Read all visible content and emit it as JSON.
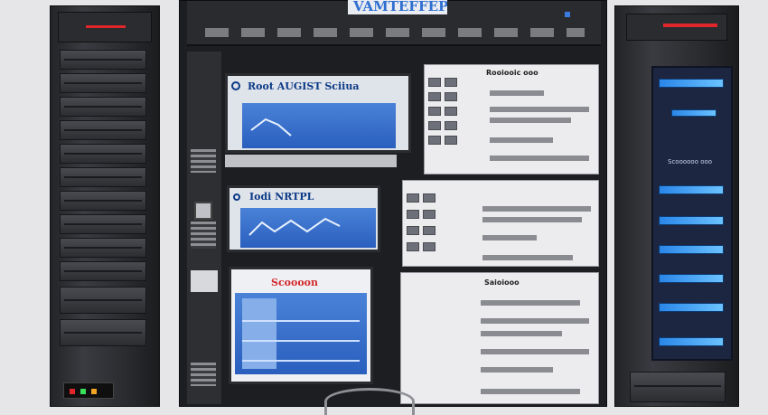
{
  "rack": {
    "banner": "VAMTEFFEP",
    "screens": [
      {
        "title": "Root AUGIST Sciiua"
      },
      {
        "title": "Iodi NRTPL"
      },
      {
        "title": "Scoooon"
      }
    ],
    "panels": [
      {
        "header": "Rooiooic ooo"
      },
      {
        "header": ""
      },
      {
        "header": "Saioiooo"
      }
    ],
    "right_tower": {
      "header": "Scoooooo ooo"
    }
  },
  "colors": {
    "accent_blue": "#2a6fd6",
    "led_red": "#e0262b",
    "rack_dark": "#1d1e21"
  }
}
